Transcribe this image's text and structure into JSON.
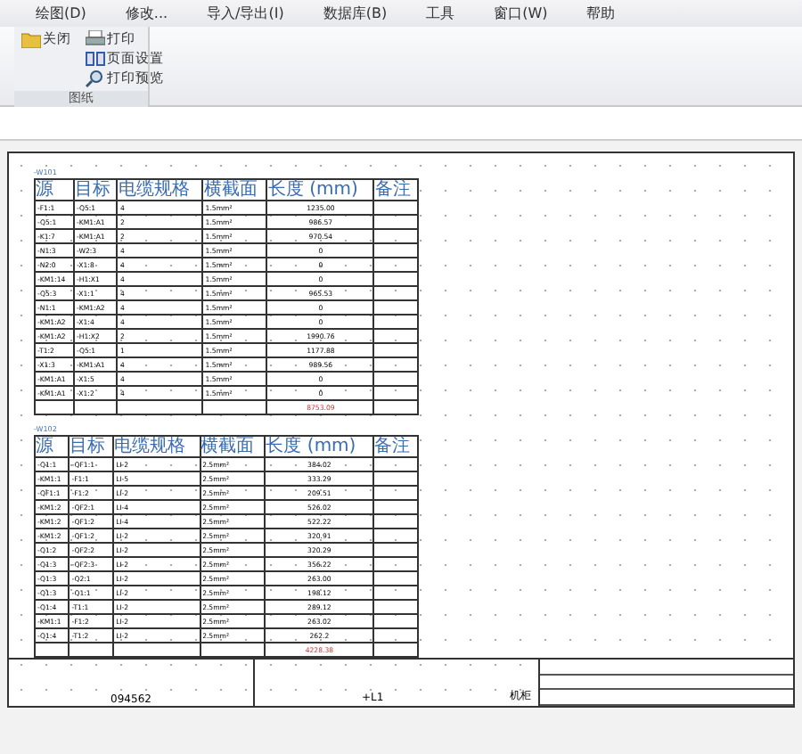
{
  "menu": [
    "绘图(D)",
    "修改...",
    "导入/导出(I)",
    "数据库(B)",
    "工具",
    "窗口(W)",
    "帮助"
  ],
  "ribbon": {
    "group_label": "图纸",
    "buttons": [
      {
        "kind": "folder",
        "label": "关闭"
      },
      {
        "kind": "printer",
        "label": "打印"
      },
      {
        "kind": "page",
        "label": "页面设置"
      },
      {
        "kind": "preview",
        "label": "打印预览"
      }
    ]
  },
  "tables": [
    {
      "title": "-W101",
      "columns": [
        "源",
        "目标",
        "电缆规格",
        "横截面",
        "长度 (mm)",
        "备注"
      ],
      "rows": [
        [
          "-F1:1",
          "-Q5:1",
          "4",
          "1.5mm²",
          "1235.00"
        ],
        [
          "-Q5:1",
          "-KM1:A1",
          "2",
          "1.5mm²",
          "986.57"
        ],
        [
          "-K1:7",
          "-KM1:A1",
          "2",
          "1.5mm²",
          "970.54"
        ],
        [
          "-N1:3",
          "-W2:3",
          "4",
          "1.5mm²",
          "0"
        ],
        [
          "-N2:0",
          "-X1:8",
          "4",
          "1.5mm²",
          "0"
        ],
        [
          "-KM1:14",
          "-H1:X1",
          "4",
          "1.5mm²",
          "0"
        ],
        [
          "-Q5:3",
          "-X1:1",
          "4",
          "1.5mm²",
          "965.53"
        ],
        [
          "-N1:1",
          "-KM1:A2",
          "4",
          "1.5mm²",
          "0"
        ],
        [
          "-KM1:A2",
          "-X1:4",
          "4",
          "1.5mm²",
          "0"
        ],
        [
          "-KM1:A2",
          "-H1:X2",
          "2",
          "1.5mm²",
          "1990.76"
        ],
        [
          "-T1:2",
          "-Q5:1",
          "1",
          "1.5mm²",
          "1177.88"
        ],
        [
          "-X1:3",
          "-KM1:A1",
          "4",
          "1.5mm²",
          "989.56"
        ],
        [
          "-KM1:A1",
          "-X1:5",
          "4",
          "1.5mm²",
          "0"
        ],
        [
          "-KM1:A1",
          "-X1:2",
          "4",
          "1.5mm²",
          "0"
        ]
      ],
      "total": "8753.09"
    },
    {
      "title": "-W102",
      "columns": [
        "源",
        "目标",
        "电缆规格",
        "横截面",
        "长度 (mm)",
        "备注"
      ],
      "rows": [
        [
          "-Q1:1",
          "-QF1:1",
          "LI-2",
          "2.5mm²",
          "384.02"
        ],
        [
          "-KM1:1",
          "-F1:1",
          "LI-5",
          "2.5mm²",
          "333.29"
        ],
        [
          "-QF1:1",
          "-F1:2",
          "LI-2",
          "2.5mm²",
          "209.51"
        ],
        [
          "-KM1:2",
          "-QF2:1",
          "LI-4",
          "2.5mm²",
          "526.02"
        ],
        [
          "-KM1:2",
          "-QF1:2",
          "LI-4",
          "2.5mm²",
          "522.22"
        ],
        [
          "-KM1:2",
          "-QF1:2",
          "LI-2",
          "2.5mm²",
          "320.91"
        ],
        [
          "-Q1:2",
          "-QF2:2",
          "LI-2",
          "2.5mm²",
          "320.29"
        ],
        [
          "-Q1:3",
          "-QF2:3",
          "LI-2",
          "2.5mm²",
          "356.22"
        ],
        [
          "-Q1:3",
          "-Q2:1",
          "LI-2",
          "2.5mm²",
          "263.00"
        ],
        [
          "-Q1:3",
          "-Q1:1",
          "LI-2",
          "2.5mm²",
          "198.12"
        ],
        [
          "-Q1:4",
          "-T1:1",
          "LI-2",
          "2.5mm²",
          "289.12"
        ],
        [
          "-KM1:1",
          "-F1:2",
          "LI-2",
          "2.5mm²",
          "263.02"
        ],
        [
          "-Q1:4",
          "-T1:2",
          "LI-2",
          "2.5mm²",
          "262.2"
        ]
      ],
      "total": "4228.38"
    }
  ],
  "title_block": {
    "drawing_no": "094562",
    "location": "+L1",
    "cabinet": "机柜"
  }
}
